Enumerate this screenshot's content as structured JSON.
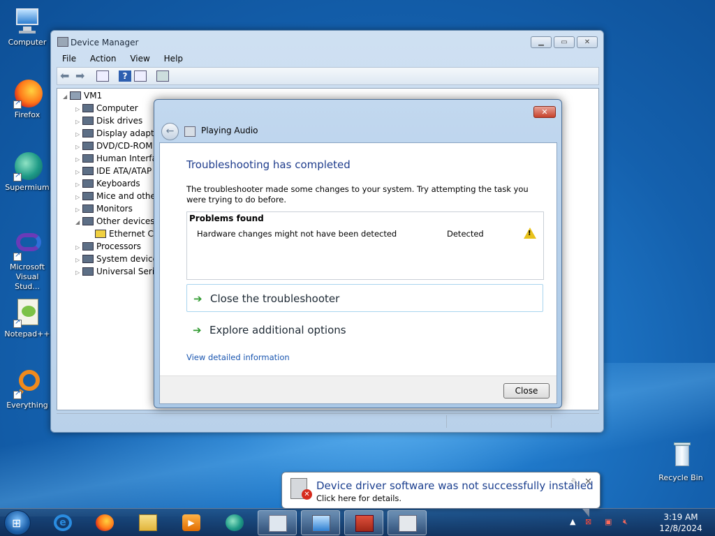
{
  "desktop": {
    "icons": [
      {
        "label": "Computer",
        "icon": "computer-icon"
      },
      {
        "label": "Firefox",
        "icon": "firefox-icon"
      },
      {
        "label": "Supermium",
        "icon": "supermium-icon"
      },
      {
        "label": "Microsoft Visual Stud...",
        "icon": "visual-studio-icon"
      },
      {
        "label": "Notepad++",
        "icon": "notepadpp-icon"
      },
      {
        "label": "Everything",
        "icon": "everything-icon"
      },
      {
        "label": "Recycle Bin",
        "icon": "recycle-bin-icon"
      }
    ]
  },
  "device_manager": {
    "title": "Device Manager",
    "menu": [
      "File",
      "Action",
      "View",
      "Help"
    ],
    "root": "VM1",
    "tree": [
      {
        "label": "Computer",
        "expand": "▷"
      },
      {
        "label": "Disk drives",
        "expand": "▷"
      },
      {
        "label": "Display adapters",
        "expand": "▷"
      },
      {
        "label": "DVD/CD-ROM drives",
        "expand": "▷"
      },
      {
        "label": "Human Interface Devices",
        "expand": "▷"
      },
      {
        "label": "IDE ATA/ATAPI controllers",
        "expand": "▷"
      },
      {
        "label": "Keyboards",
        "expand": "▷"
      },
      {
        "label": "Mice and other pointing devices",
        "expand": "▷"
      },
      {
        "label": "Monitors",
        "expand": "▷"
      },
      {
        "label": "Other devices",
        "expand": "◢"
      },
      {
        "label": "Ethernet Controller",
        "expand": ""
      },
      {
        "label": "Processors",
        "expand": "▷"
      },
      {
        "label": "System devices",
        "expand": "▷"
      },
      {
        "label": "Universal Serial Bus controllers",
        "expand": "▷"
      }
    ],
    "tree_visible": [
      "Computer",
      "Disk drives",
      "Display adapte",
      "DVD/CD-ROM",
      "Human Interfa",
      "IDE ATA/ATAP",
      "Keyboards",
      "Mice and othe",
      "Monitors",
      "Other devices",
      "Ethernet Co",
      "Processors",
      "System devices",
      "Universal Seria"
    ]
  },
  "troubleshooter": {
    "app_title": "Playing Audio",
    "heading": "Troubleshooting has completed",
    "description": "The troubleshooter made some changes to your system. Try attempting the task you were trying to do before.",
    "problems_header": "Problems found",
    "problem": {
      "name": "Hardware changes might not have been detected",
      "status": "Detected"
    },
    "options": [
      "Close the troubleshooter",
      "Explore additional options"
    ],
    "detail_link": "View detailed information",
    "close_button": "Close"
  },
  "notification": {
    "title": "Device driver software was not successfully installed",
    "subtitle": "Click here for details."
  },
  "taskbar": {
    "time": "3:19 AM",
    "date": "12/8/2024"
  }
}
